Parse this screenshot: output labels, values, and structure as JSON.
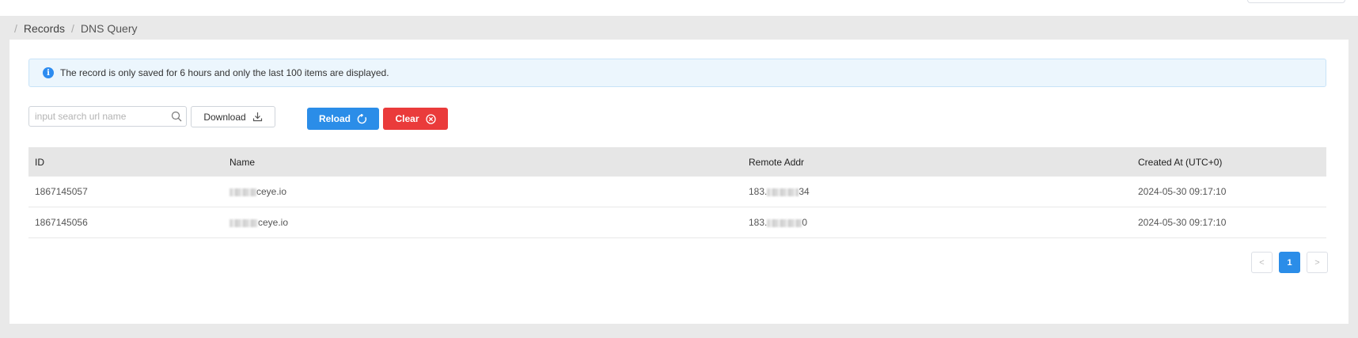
{
  "breadcrumb": {
    "separator": "/",
    "items": [
      "Records",
      "DNS Query"
    ]
  },
  "alert": {
    "icon": "info-icon",
    "text": "The record is only saved for 6 hours and only the last 100 items are displayed."
  },
  "toolbar": {
    "search_placeholder": "input search url name",
    "search_value": "",
    "download_label": "Download",
    "reload_label": "Reload",
    "clear_label": "Clear"
  },
  "colors": {
    "reload": "#2b8de8",
    "clear": "#ea3b3b",
    "alert_bg": "#ecf6fd",
    "header_bg": "#e6e6e6"
  },
  "table": {
    "columns": [
      "ID",
      "Name",
      "Remote Addr",
      "Created At (UTC+0)"
    ],
    "rows": [
      {
        "id": "1867145057",
        "name_suffix": "ceye.io",
        "addr_prefix": "183.",
        "addr_suffix": "34",
        "created": "2024-05-30 09:17:10"
      },
      {
        "id": "1867145056",
        "name_suffix": "ceye.io",
        "addr_prefix": "183.",
        "addr_suffix": "0",
        "created": "2024-05-30 09:17:10"
      }
    ]
  },
  "pagination": {
    "prev": "<",
    "current": "1",
    "next": ">"
  }
}
